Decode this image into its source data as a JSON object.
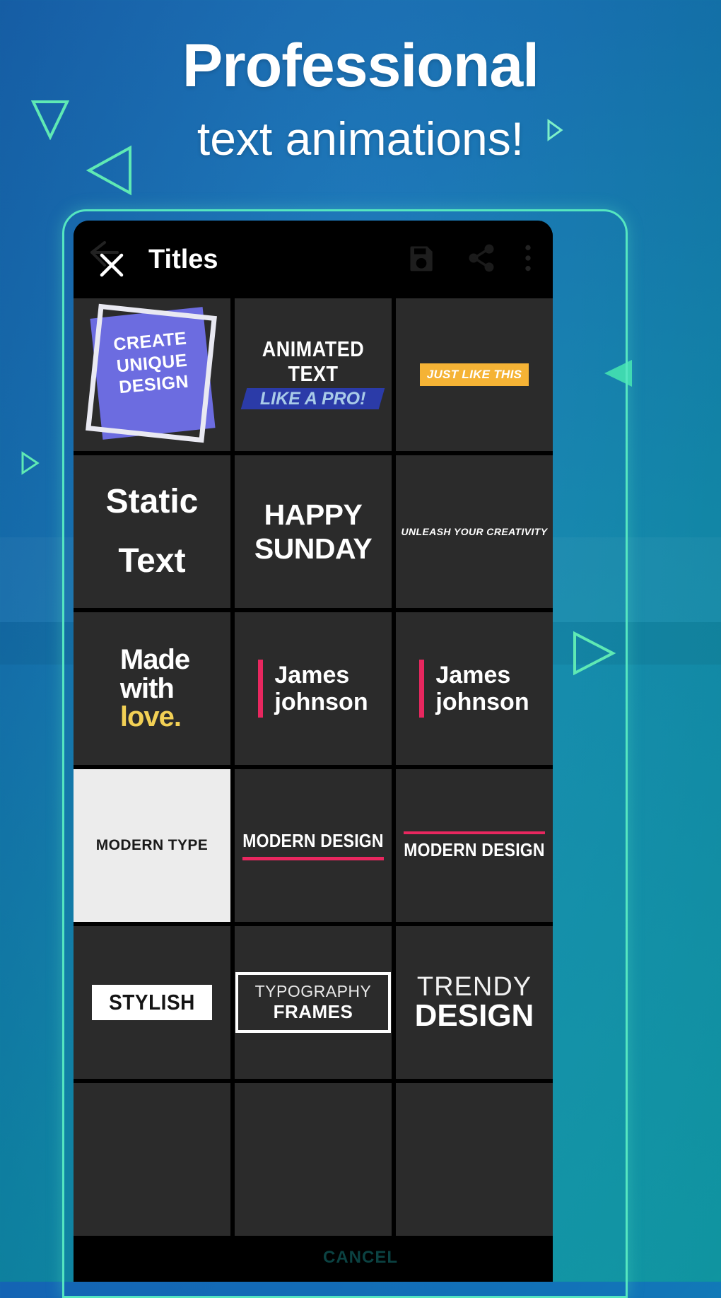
{
  "background": {
    "gradient_from": "#1464b4",
    "gradient_to": "#12a9b6",
    "accent_green": "#55e6c0"
  },
  "headline": {
    "line1": "Professional",
    "line2": "text animations!"
  },
  "device": {
    "frame_color": "#55e6c0",
    "screen_background": "#000000"
  },
  "toolbar": {
    "title": "Titles",
    "close_label": "✕",
    "back_icon": "back-arrow-icon",
    "save_icon": "save-floppy-icon",
    "share_icon": "share-icon",
    "more_icon": "overflow-menu-icon"
  },
  "grid": {
    "columns": 3,
    "tile_background": "#2b2b2b",
    "tiles": [
      {
        "id": "create-unique-design",
        "kind": "rotated-frame",
        "lines": [
          "CREATE",
          "UNIQUE",
          "DESIGN"
        ],
        "shape_color": "#6c6ce0",
        "frame_color": "#e9e9f2",
        "text_color": "#ffffff"
      },
      {
        "id": "animated-text-like-a-pro",
        "kind": "banner",
        "top_text": "ANIMATED TEXT",
        "bottom_text": "LIKE A PRO!",
        "bar_color": "#2b3ba8",
        "bottom_text_color": "#a9cbe8"
      },
      {
        "id": "just-like-this",
        "kind": "highlight-bar",
        "text": "JUST LIKE THIS",
        "bar_color": "#f5b335",
        "text_color": "#ffffff"
      },
      {
        "id": "static-text",
        "kind": "plain",
        "line1": "Static",
        "line2": "Text",
        "text_color": "#ffffff"
      },
      {
        "id": "happy-sunday",
        "kind": "plain",
        "line1": "HAPPY",
        "line2": "SUNDAY",
        "text_color": "#ffffff"
      },
      {
        "id": "unleash-your-creativity",
        "kind": "small-italic",
        "text": "UNLEASH YOUR CREATIVITY",
        "text_color": "#ffffff"
      },
      {
        "id": "made-with-love",
        "kind": "stacked-accent",
        "line1": "Made",
        "line2": "with",
        "line3": "love.",
        "accent_color": "#f2d055",
        "text_color": "#ffffff"
      },
      {
        "id": "james-johnson-1",
        "kind": "side-bar",
        "line1": "James",
        "line2": "johnson",
        "bar_color": "#e8275f",
        "text_color": "#ffffff"
      },
      {
        "id": "james-johnson-2",
        "kind": "side-bar",
        "line1": "James",
        "line2": "johnson",
        "bar_color": "#e8275f",
        "text_color": "#ffffff"
      },
      {
        "id": "modern-type",
        "kind": "light",
        "text": "MODERN TYPE",
        "background": "#ececec",
        "text_color": "#1a1a1a"
      },
      {
        "id": "modern-design-underline",
        "kind": "underline",
        "text": "MODERN DESIGN",
        "rule_color": "#e8275f",
        "text_color": "#ffffff"
      },
      {
        "id": "modern-design-overline",
        "kind": "overline",
        "text": "MODERN DESIGN",
        "rule_color": "#e8275f",
        "text_color": "#ffffff"
      },
      {
        "id": "stylish",
        "kind": "inverse-box",
        "text": "STYLISH",
        "box_color": "#ffffff",
        "text_color": "#151515"
      },
      {
        "id": "typography-frames",
        "kind": "outline-box",
        "line1": "TYPOGRAPHY",
        "line2": "FRAMES",
        "border_color": "#ffffff",
        "text_color": "#ffffff"
      },
      {
        "id": "trendy-design",
        "kind": "two-weight",
        "line1": "TRENDY",
        "line2": "DESIGN",
        "text_color": "#ffffff"
      },
      {
        "id": "tile-row6-1",
        "kind": "empty"
      },
      {
        "id": "tile-row6-2",
        "kind": "empty"
      },
      {
        "id": "tile-row6-3",
        "kind": "empty"
      }
    ]
  },
  "overlay": {
    "cancel_text": "CANCEL"
  }
}
